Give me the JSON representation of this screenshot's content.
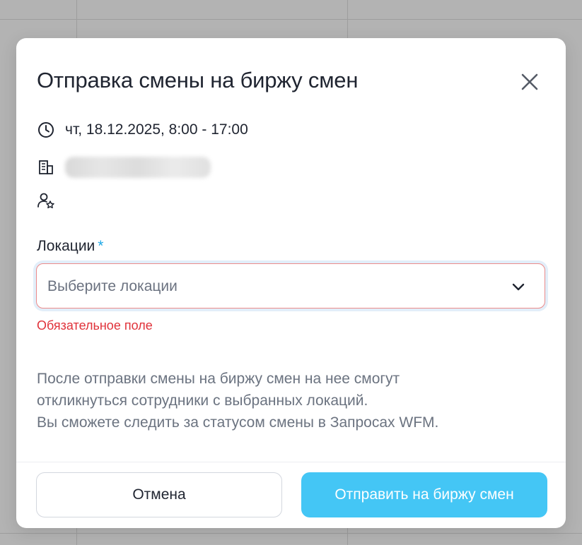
{
  "dialog": {
    "title": "Отправка смены на биржу смен",
    "close_icon": "close-icon"
  },
  "shift": {
    "datetime": "чт, 18.12.2025, 8:00 - 17:00",
    "datetime_icon": "clock-icon",
    "org_icon": "building-icon",
    "role_icon": "user-star-icon"
  },
  "locations": {
    "label": "Локации",
    "required_mark": "*",
    "placeholder": "Выберите локации",
    "error": "Обязательное поле"
  },
  "note": {
    "line1": "После отправки смены на биржу смен на нее смогут",
    "line2": "откликнуться сотрудники с выбранных локаций.",
    "line3": "Вы сможете следить за статусом смены в Запросах WFM."
  },
  "actions": {
    "cancel_label": "Отмена",
    "submit_label": "Отправить на биржу смен"
  },
  "colors": {
    "accent": "#44c6f5",
    "required": "#1fa8e6",
    "error": "#e0323a",
    "overlay": "#b3b3b3"
  }
}
